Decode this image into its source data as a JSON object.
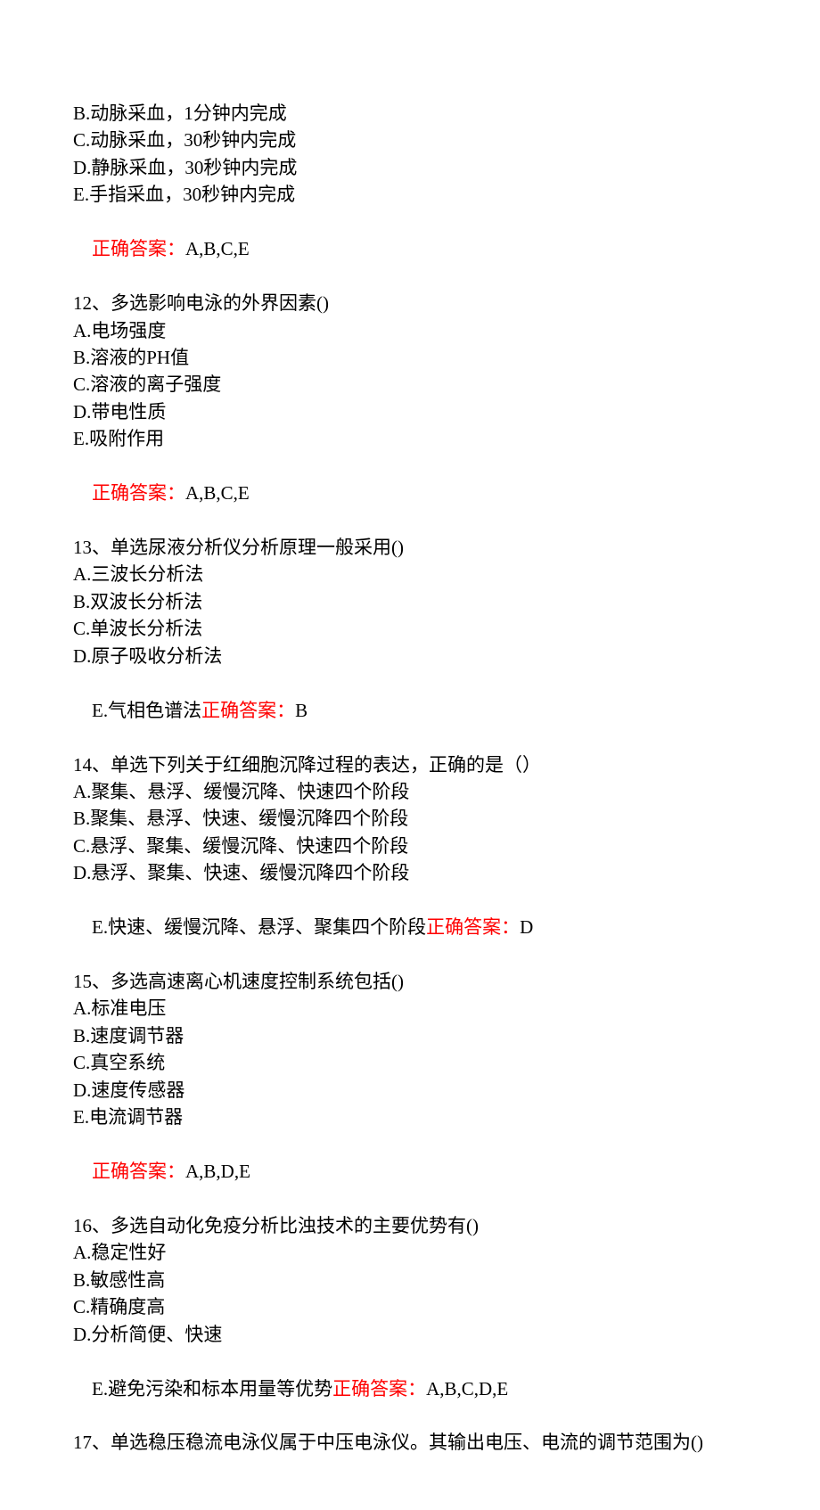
{
  "q11_tail": {
    "options": [
      "B.动脉采血，1分钟内完成",
      "C.动脉采血，30秒钟内完成",
      "D.静脉采血，30秒钟内完成",
      "E.手指采血，30秒钟内完成"
    ],
    "answer_label": "正确答案：",
    "answer_value": "A,B,C,E"
  },
  "q12": {
    "stem": "12、多选影响电泳的外界因素()",
    "options": [
      "A.电场强度",
      "B.溶液的PH值",
      "C.溶液的离子强度",
      "D.带电性质",
      "E.吸附作用"
    ],
    "answer_label": "正确答案：",
    "answer_value": "A,B,C,E"
  },
  "q13": {
    "stem": "13、单选尿液分析仪分析原理一般采用()",
    "options": [
      "A.三波长分析法",
      "B.双波长分析法",
      "C.单波长分析法",
      "D.原子吸收分析法"
    ],
    "last_option_prefix": "E.气相色谱法",
    "answer_label": "正确答案：",
    "answer_value": "B"
  },
  "q14": {
    "stem": "14、单选下列关于红细胞沉降过程的表达，正确的是（）",
    "options": [
      "A.聚集、悬浮、缓慢沉降、快速四个阶段",
      "B.聚集、悬浮、快速、缓慢沉降四个阶段",
      "C.悬浮、聚集、缓慢沉降、快速四个阶段",
      "D.悬浮、聚集、快速、缓慢沉降四个阶段"
    ],
    "last_option_prefix": "E.快速、缓慢沉降、悬浮、聚集四个阶段",
    "answer_label": "正确答案：",
    "answer_value": "D"
  },
  "q15": {
    "stem": "15、多选高速离心机速度控制系统包括()",
    "options": [
      "A.标准电压",
      "B.速度调节器",
      "C.真空系统",
      "D.速度传感器",
      "E.电流调节器"
    ],
    "answer_label": "正确答案：",
    "answer_value": "A,B,D,E"
  },
  "q16": {
    "stem": "16、多选自动化免疫分析比浊技术的主要优势有()",
    "options": [
      "A.稳定性好",
      "B.敏感性高",
      "C.精确度高",
      "D.分析简便、快速"
    ],
    "last_option_prefix": "E.避免污染和标本用量等优势",
    "answer_label": "正确答案：",
    "answer_value": "A,B,C,D,E"
  },
  "q17": {
    "stem": "17、单选稳压稳流电泳仪属于中压电泳仪。其输出电压、电流的调节范围为()"
  }
}
